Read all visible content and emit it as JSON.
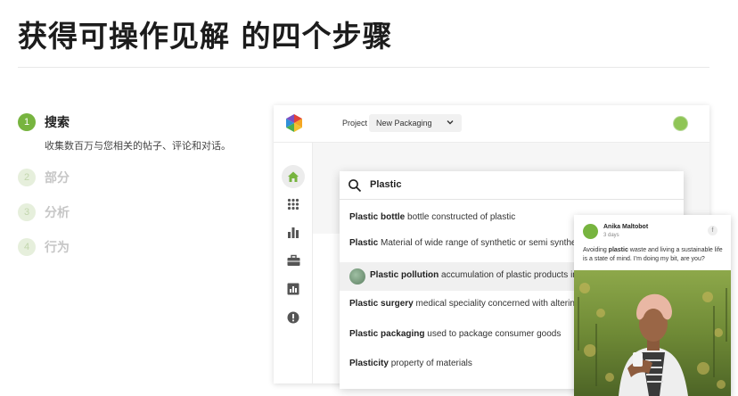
{
  "title": "获得可操作见解 的四个步骤",
  "steps": [
    {
      "num": "1",
      "label": "搜索",
      "desc": "收集数百万与您相关的帖子、评论和对话。"
    },
    {
      "num": "2",
      "label": "部分"
    },
    {
      "num": "3",
      "label": "分析"
    },
    {
      "num": "4",
      "label": "行为"
    }
  ],
  "app": {
    "project_label": "Project",
    "project_value": "New Packaging",
    "sidebar_icons": [
      "home-icon",
      "apps-grid-icon",
      "bar-chart-icon",
      "briefcase-icon",
      "report-icon",
      "alert-icon"
    ]
  },
  "search": {
    "value": "Plastic",
    "results": [
      {
        "term": "Plastic bottle",
        "desc": "bottle constructed of plastic"
      },
      {
        "term": "Plastic",
        "desc": "Material of wide range of synthetic or semi synthetic"
      },
      {
        "term": "Plastic pollution",
        "desc": "accumulation of plastic products in the"
      },
      {
        "term": "Plastic surgery",
        "desc": "medical speciality concerned with altering"
      },
      {
        "term": "Plastic packaging",
        "desc": "used to package consumer goods"
      },
      {
        "term": "Plasticity",
        "desc": "property of materials"
      }
    ]
  },
  "card": {
    "name": "Anika Maltobot",
    "time": "3 days",
    "badge": "f",
    "text_before": "Avoiding ",
    "text_bold": "plastic",
    "text_after": " waste and living a sustainable life is a state of mind. I'm doing my bit, are you?"
  },
  "colors": {
    "accent": "#77b43f",
    "accent_light": "#e6efdc"
  }
}
